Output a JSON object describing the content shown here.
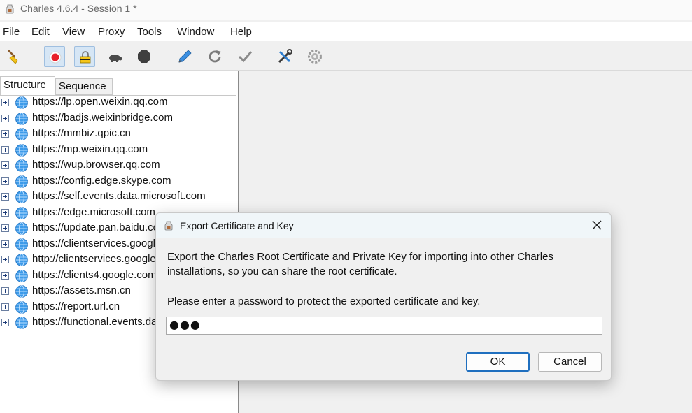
{
  "window": {
    "title": "Charles 4.6.4 - Session 1 *",
    "app_icon": "charles-jug-icon"
  },
  "menubar": {
    "items": [
      "File",
      "Edit",
      "View",
      "Proxy",
      "Tools",
      "Window",
      "Help"
    ]
  },
  "toolbar": {
    "buttons": [
      {
        "icon": "broom-icon",
        "state": "normal"
      },
      {
        "icon": "record-icon",
        "state": "active"
      },
      {
        "icon": "ssl-proxying-icon",
        "state": "active"
      },
      {
        "icon": "throttle-turtle-icon",
        "state": "normal"
      },
      {
        "icon": "stop-breakpoints-icon",
        "state": "normal"
      },
      {
        "icon": "compose-pen-icon",
        "state": "normal"
      },
      {
        "icon": "repeat-icon",
        "state": "normal"
      },
      {
        "icon": "validate-check-icon",
        "state": "normal"
      },
      {
        "icon": "tools-icon",
        "state": "normal"
      },
      {
        "icon": "settings-gear-icon",
        "state": "normal"
      }
    ]
  },
  "left_pane": {
    "tabs": [
      "Structure",
      "Sequence"
    ],
    "active_tab": "Structure",
    "hosts": [
      "https://lp.open.weixin.qq.com",
      "https://badjs.weixinbridge.com",
      "https://mmbiz.qpic.cn",
      "https://mp.weixin.qq.com",
      "https://wup.browser.qq.com",
      "https://config.edge.skype.com",
      "https://self.events.data.microsoft.com",
      "https://edge.microsoft.com",
      "https://update.pan.baidu.com",
      "https://clientservices.googleapis.com",
      "http://clientservices.googleapis.com",
      "https://clients4.google.com",
      "https://assets.msn.cn",
      "https://report.url.cn",
      "https://functional.events.data.microsoft.com"
    ]
  },
  "dialog": {
    "title": "Export Certificate and Key",
    "message_line1": "Export the Charles Root Certificate and Private Key for importing into other Charles installations, so you can share the root certificate.",
    "message_line2": "Please enter a password to protect the exported certificate and key.",
    "password_value": "●●●",
    "ok_label": "OK",
    "cancel_label": "Cancel"
  }
}
